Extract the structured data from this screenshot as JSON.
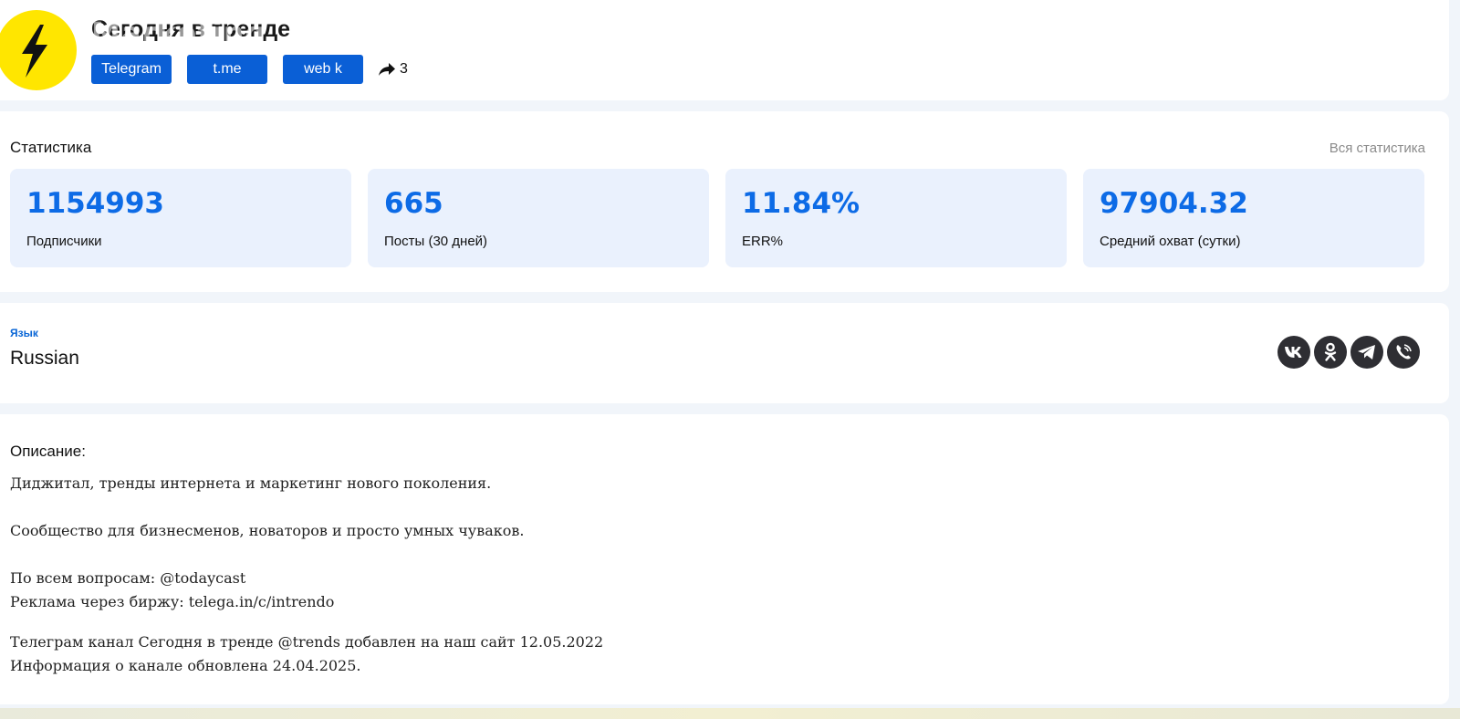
{
  "channel": {
    "title": "Сегодня в тренде",
    "title_ghost": "Marketing"
  },
  "links": {
    "telegram": "Telegram",
    "tme": "t.me",
    "webk": "web k",
    "share_count": "3"
  },
  "stats": {
    "title": "Статистика",
    "all_link": "Вся статистика",
    "items": [
      {
        "value": "1154993",
        "label": "Подписчики"
      },
      {
        "value": "665",
        "label": "Посты (30 дней)"
      },
      {
        "value": "11.84%",
        "label": "ERR%"
      },
      {
        "value": "97904.32",
        "label": "Средний охват (сутки)"
      }
    ]
  },
  "language": {
    "label": "Язык",
    "value": "Russian",
    "share_icons": [
      "vk-icon",
      "odnoklassniki-icon",
      "telegram-icon",
      "viber-icon"
    ]
  },
  "description": {
    "title": "Описание",
    "colon": ":",
    "lines": [
      "Диджитал, тренды интернета и маркетинг нового поколения.",
      "Сообщество для бизнесменов, новаторов и просто умных чуваков.",
      "По всем вопросам: @todaycast",
      "Реклама через биржу: telega.in/c/intrendo",
      "Телеграм канал Сегодня в тренде @trends добавлен на наш сайт 12.05.2022",
      "Информация о канале обновлена 24.04.2025."
    ]
  },
  "colors": {
    "accent": "#0a5fd6",
    "stat_value": "#0d6be6",
    "avatar_bg": "#ffe600"
  }
}
